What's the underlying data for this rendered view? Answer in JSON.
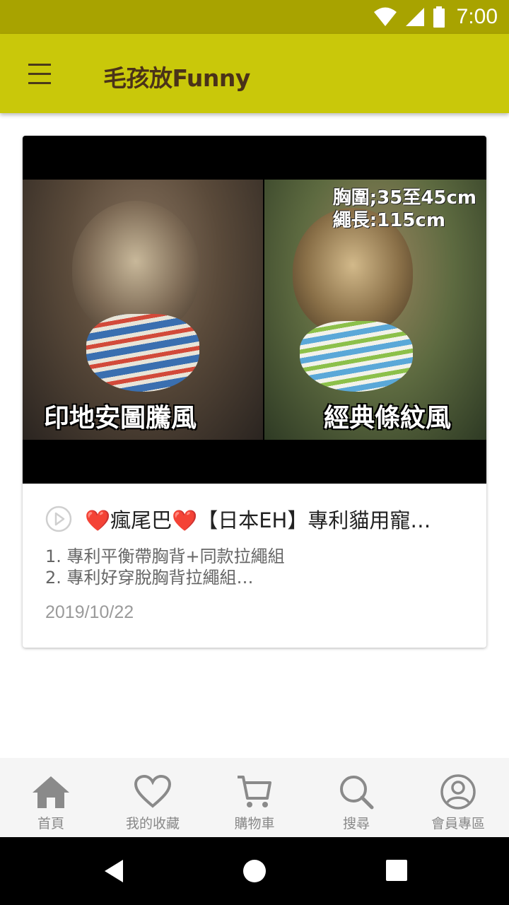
{
  "status": {
    "time": "7:00"
  },
  "app": {
    "title": "毛孩放Funny"
  },
  "card": {
    "image_left_caption": "印地安圖騰風",
    "image_right_caption": "經典條紋風",
    "image_spec_line1": "胸圍;35至45cm",
    "image_spec_line2": "繩長:115cm",
    "title": "❤️瘋尾巴❤️【日本EH】專利貓用寵…",
    "desc_line1": "1. 專利平衡帶胸背+同款拉繩組",
    "desc_line2": "2. 專利好穿脫胸背拉繩組…",
    "date": "2019/10/22"
  },
  "nav": {
    "items": [
      {
        "label": "首頁",
        "icon": "home-icon"
      },
      {
        "label": "我的收藏",
        "icon": "heart-icon"
      },
      {
        "label": "購物車",
        "icon": "cart-icon"
      },
      {
        "label": "搜尋",
        "icon": "search-icon"
      },
      {
        "label": "會員專區",
        "icon": "account-icon"
      }
    ]
  },
  "colors": {
    "status_bar": "#a8a300",
    "app_bar": "#c9c80a",
    "title_text": "#4a3219",
    "nav_icon": "#8a8a8a"
  }
}
